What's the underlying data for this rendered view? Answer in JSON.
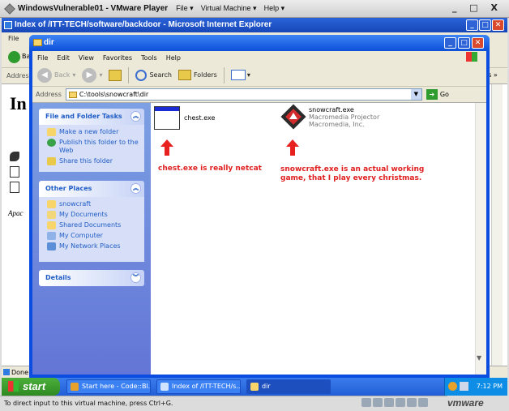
{
  "vmware": {
    "title": "WindowsVulnerable01 - VMware Player",
    "menus": [
      "File ▾",
      "Virtual Machine ▾",
      "Help ▾"
    ],
    "controls": "_ □ X",
    "status_hint": "To direct input to this virtual machine, press Ctrl+G.",
    "logo": "vmware"
  },
  "ie": {
    "title": "Index of /ITT-TECH/software/backdoor - Microsoft Internet Explorer",
    "menu_visible": "File",
    "toolbar_fragment": "Ba",
    "address_label": "Address",
    "heading_fragment": "In",
    "footer_fragment": "Apac",
    "status": "Done",
    "right_fragment": "ıs »"
  },
  "dir": {
    "title": "dir",
    "menu": [
      "File",
      "Edit",
      "View",
      "Favorites",
      "Tools",
      "Help"
    ],
    "toolbar": {
      "back": "Back",
      "search": "Search",
      "folders": "Folders"
    },
    "address_label": "Address",
    "address_value": "C:\\tools\\snowcraft\\dir",
    "go_label": "Go",
    "file_tasks": {
      "header": "File and Folder Tasks",
      "items": [
        "Make a new folder",
        "Publish this folder to the Web",
        "Share this folder"
      ]
    },
    "other_places": {
      "header": "Other Places",
      "items": [
        "snowcraft",
        "My Documents",
        "Shared Documents",
        "My Computer",
        "My Network Places"
      ]
    },
    "details": {
      "header": "Details"
    },
    "files": [
      {
        "name": "chest.exe"
      },
      {
        "name": "snowcraft.exe",
        "line2": "Macromedia Projector",
        "line3": "Macromedia, Inc."
      }
    ],
    "annotation_chest": "chest.exe is really netcat",
    "annotation_snow_1": "snowcraft.exe is an actual working",
    "annotation_snow_2": "game, that I play every christmas."
  },
  "taskbar": {
    "start": "start",
    "tasks": [
      "Start here - Code::Bl...",
      "Index of /ITT-TECH/s...",
      "dir"
    ],
    "clock": "7:12 PM"
  }
}
